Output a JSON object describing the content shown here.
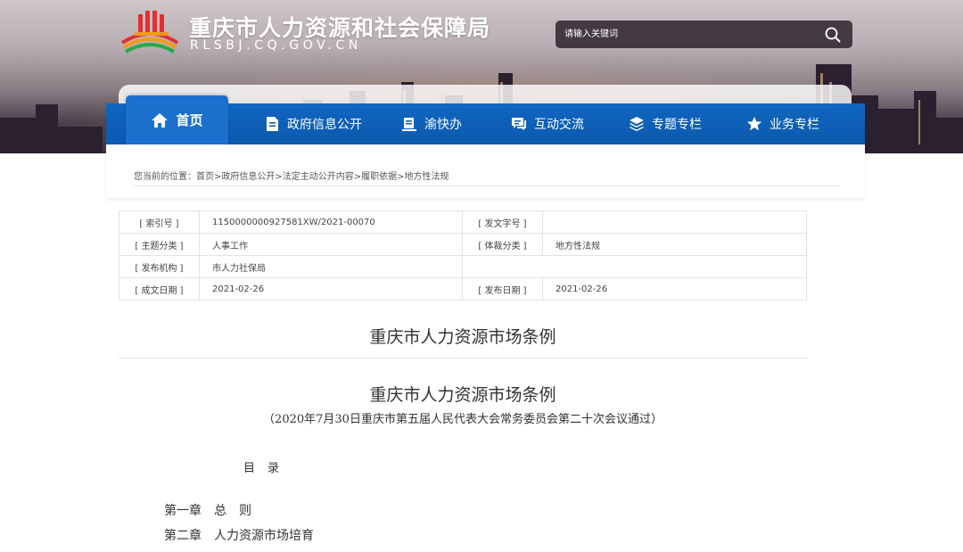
{
  "header": {
    "title": "重庆市人力资源和社会保障局",
    "domain": "RLSBJ.CQ.GOV.CN",
    "search_placeholder": "请输入关键词"
  },
  "nav": {
    "items": [
      {
        "label": "首页",
        "icon": "home-icon"
      },
      {
        "label": "政府信息公开",
        "icon": "document-icon"
      },
      {
        "label": "渝快办",
        "icon": "book-icon"
      },
      {
        "label": "互动交流",
        "icon": "chat-icon"
      },
      {
        "label": "专题专栏",
        "icon": "layers-icon"
      },
      {
        "label": "业务专栏",
        "icon": "star-icon"
      }
    ]
  },
  "breadcrumb": {
    "prefix": "您当前的位置：",
    "items": [
      "首页",
      "政府信息公开",
      "法定主动公开内容",
      "履职依据",
      "地方性法规"
    ],
    "separator": ">"
  },
  "meta": {
    "index_label": "[ 索引号 ]",
    "index_value": "1150000000927581XW/2021-00070",
    "doc_no_label": "[ 发文字号 ]",
    "doc_no_value": "",
    "topic_label": "[ 主题分类 ]",
    "topic_value": "人事工作",
    "genre_label": "[ 体裁分类 ]",
    "genre_value": "地方性法规",
    "org_label": "[ 发布机构 ]",
    "org_value": "市人力社保局",
    "created_label": "[ 成文日期 ]",
    "created_value": "2021-02-26",
    "published_label": "[ 发布日期 ]",
    "published_value": "2021-02-26"
  },
  "article": {
    "page_title": "重庆市人力资源市场条例",
    "doc_title": "重庆市人力资源市场条例",
    "subtitle": "（2020年7月30日重庆市第五届人民代表大会常务委员会第二十次会议通过）",
    "toc_heading": "目录",
    "chapters": [
      {
        "no": "第一章",
        "name": "总　则"
      },
      {
        "no": "第二章",
        "name": "人力资源市场培育"
      }
    ]
  },
  "colors": {
    "nav_blue": "#0b5aae",
    "nav_active": "#1a70cc"
  }
}
